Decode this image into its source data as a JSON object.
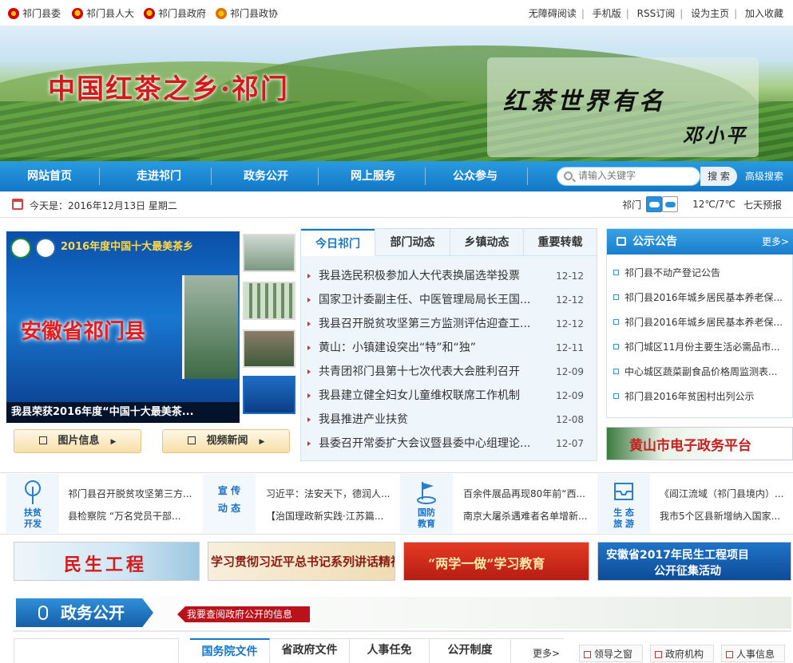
{
  "top_links": [
    "祁门县委",
    "祁门县人大",
    "祁门县政府",
    "祁门县政协"
  ],
  "top_right_links": [
    "无障碍阅读",
    "手机版",
    "RSS订阅",
    "设为主页",
    "加入收藏"
  ],
  "banner": {
    "title": "中国红茶之乡·祁门",
    "calligraphy_line1": "红茶世界有名",
    "calligraphy_line2": "邓小平"
  },
  "nav": {
    "items": [
      "网站首页",
      "走进祁门",
      "政务公开",
      "网上服务",
      "公众参与"
    ],
    "search_placeholder": "请输入关键字",
    "search_button": "搜 索",
    "advanced_search": "高级搜索"
  },
  "datebar": {
    "date_text": "今天是：2016年12月13日  星期二",
    "city": "祁门",
    "temperature": "12℃/7℃",
    "forecast_link": "七天预报"
  },
  "slideshow": {
    "headline": "2016年度中国十大最美茶乡",
    "big_text": "安徽省祁门县",
    "caption": "我县荣获2016年度“中国十大最美茶...",
    "thumbnail_count": 4,
    "active_thumbnail": 4
  },
  "buttons": {
    "picture_info": "图片信息",
    "video_news": "视频新闻"
  },
  "news": {
    "tabs": [
      "今日祁门",
      "部门动态",
      "乡镇动态",
      "重要转载"
    ],
    "active_tab": "今日祁门",
    "items": [
      {
        "title": "我县选民积极参加人大代表换届选举投票",
        "date": "12-12"
      },
      {
        "title": "国家卫计委副主任、中医管理局局长王国...",
        "date": "12-12"
      },
      {
        "title": "我县召开脱贫攻坚第三方监测评估迎查工...",
        "date": "12-12"
      },
      {
        "title": "黄山：小镇建设突出“特”和“独”",
        "date": "12-11"
      },
      {
        "title": "共青团祁门县第十七次代表大会胜利召开",
        "date": "12-09"
      },
      {
        "title": "我县建立健全妇女儿童维权联席工作机制",
        "date": "12-09"
      },
      {
        "title": "我县推进产业扶贫",
        "date": "12-08"
      },
      {
        "title": "县委召开常委扩大会议暨县委中心组理论...",
        "date": "12-07"
      }
    ]
  },
  "notice": {
    "title": "公示公告",
    "more": "更多>",
    "items": [
      "祁门县不动产登记公告",
      "祁门县2016年城乡居民基本养老保...",
      "祁门县2016年城乡居民基本养老保...",
      "祁门城区11月份主要生活必需品市...",
      "中心城区蔬菜副食品价格周监测表...",
      "祁门县2016年贫困村出列公示"
    ]
  },
  "huangshan_banner": "黄山市电子政务平台",
  "topics": [
    {
      "label_line1": "扶贫",
      "label_line2": "开发",
      "news": [
        "祁门县召开脱贫攻坚第三方...",
        "县检察院 “万名党员干部..."
      ]
    },
    {
      "label_line1": "宣 传",
      "label_line2": "动 态",
      "news": [
        "习近平：法安天下，德润人...",
        "【治国理政新实践·江苏篇..."
      ]
    },
    {
      "label_line1": "国防",
      "label_line2": "教育",
      "news": [
        "百余件展品再现80年前“西...",
        "南京大屠杀遇难者名单增新..."
      ]
    },
    {
      "label_line1": "生 态",
      "label_line2": "旅 游",
      "news": [
        "《阊江流域（祁门县境内）...",
        "我市5个区县新增纳入国家..."
      ]
    }
  ],
  "promos": [
    "民生工程",
    "学习贯彻习近平总书记系列讲话精神",
    "“两学一做”学习教育",
    "安徽省2017年民生工程项目",
    "公开征集活动"
  ],
  "gov_section": {
    "title": "政务公开",
    "slogan": "我要查阅政府公开的信息",
    "tabs": [
      "国务院文件",
      "省政府文件",
      "人事任免",
      "公开制度"
    ],
    "more": "更多>",
    "side_links": [
      "领导之窗",
      "政府机构",
      "人事信息"
    ]
  },
  "colors": {
    "nav_blue": "#1677c9",
    "banner_red": "#d4191b",
    "slogan_red": "#b9121b"
  }
}
